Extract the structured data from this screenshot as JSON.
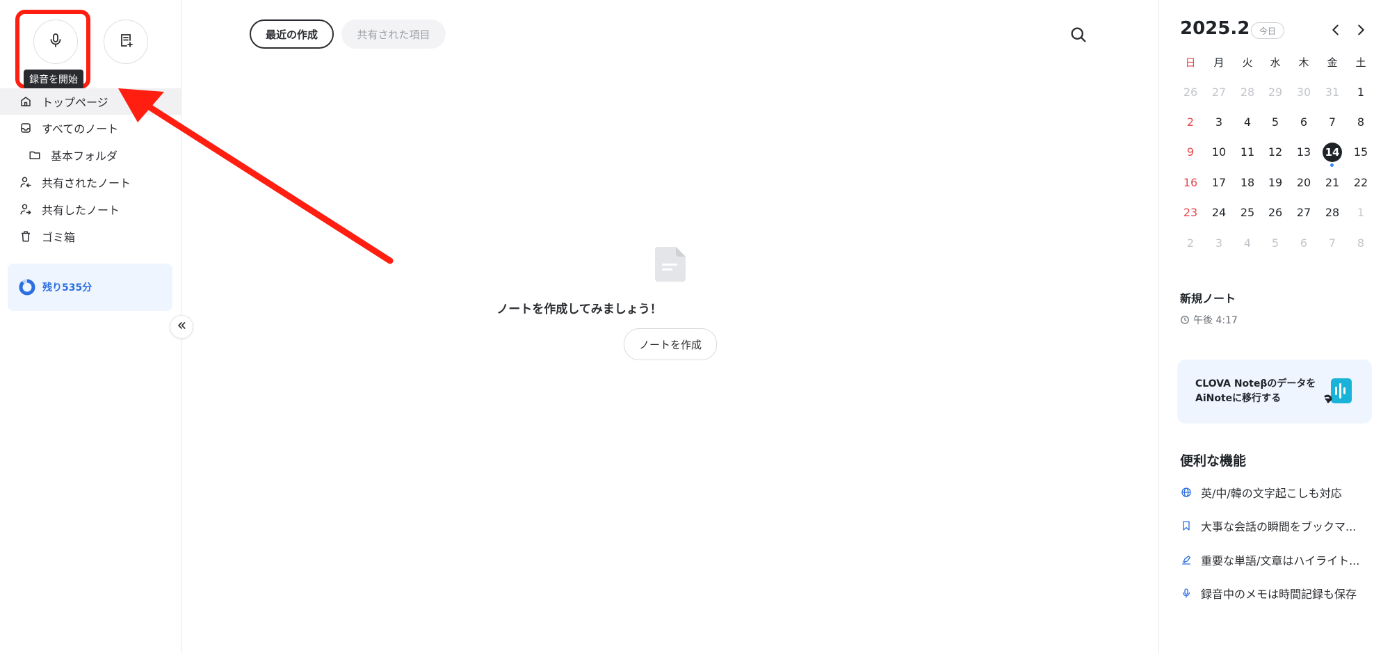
{
  "sidebar": {
    "tooltip": "録音を開始",
    "nav": [
      {
        "label": "トップページ",
        "icon": "home-icon"
      },
      {
        "label": "すべてのノート",
        "icon": "inbox-icon"
      },
      {
        "label": "基本フォルダ",
        "icon": "folder-icon"
      },
      {
        "label": "共有されたノート",
        "icon": "user-incoming-icon"
      },
      {
        "label": "共有したノート",
        "icon": "user-outgoing-icon"
      },
      {
        "label": "ゴミ箱",
        "icon": "trash-icon"
      }
    ],
    "quota_label": "残り535分"
  },
  "main": {
    "tabs": [
      {
        "label": "最近の作成",
        "active": true
      },
      {
        "label": "共有された項目",
        "active": false
      }
    ],
    "empty_title": "ノートを作成してみましょう！",
    "create_label": "ノートを作成"
  },
  "calendar": {
    "title": "2025.2",
    "today_label": "今日",
    "weekdays": [
      "日",
      "月",
      "火",
      "水",
      "木",
      "金",
      "土"
    ],
    "weeks": [
      [
        "26",
        "27",
        "28",
        "29",
        "30",
        "31",
        "1"
      ],
      [
        "2",
        "3",
        "4",
        "5",
        "6",
        "7",
        "8"
      ],
      [
        "9",
        "10",
        "11",
        "12",
        "13",
        "14",
        "15"
      ],
      [
        "16",
        "17",
        "18",
        "19",
        "20",
        "21",
        "22"
      ],
      [
        "23",
        "24",
        "25",
        "26",
        "27",
        "28",
        "1"
      ],
      [
        "2",
        "3",
        "4",
        "5",
        "6",
        "7",
        "8"
      ]
    ],
    "selected": "14"
  },
  "recent_note": {
    "title": "新規ノート",
    "time": "午後 4:17"
  },
  "promo": {
    "line1": "CLOVA Noteβのデータを",
    "line2": "AiNoteに移行する"
  },
  "features": {
    "title": "便利な機能",
    "items": [
      {
        "label": "英/中/韓の文字起こしも対応",
        "icon": "globe-icon"
      },
      {
        "label": "大事な会話の瞬間をブックマ...",
        "icon": "bookmark-icon"
      },
      {
        "label": "重要な単語/文章はハイライト...",
        "icon": "highlighter-icon"
      },
      {
        "label": "録音中のメモは時間記録も保存",
        "icon": "microphone-icon"
      }
    ]
  },
  "colors": {
    "accent": "#2c6fe0",
    "annotation_red": "#ff1e0f",
    "sunday": "#e5484d"
  }
}
